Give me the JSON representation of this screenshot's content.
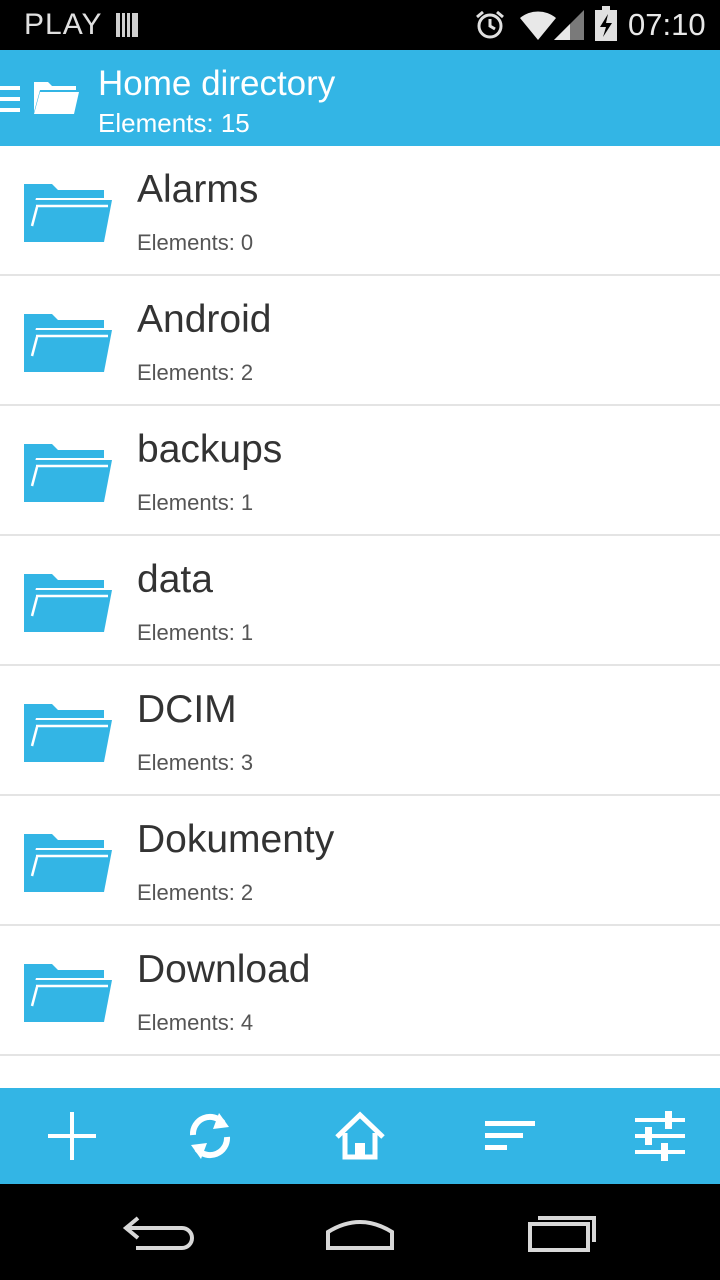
{
  "status_bar": {
    "carrier": "PLAY",
    "time": "07:10",
    "icons": [
      "sim-card-icon",
      "alarm-icon",
      "wifi-icon",
      "signal-icon",
      "battery-charging-icon"
    ]
  },
  "app_bar": {
    "title": "Home directory",
    "subtitle": "Elements: 15",
    "icons": [
      "drawer-menu-icon",
      "folder-icon"
    ]
  },
  "files": [
    {
      "name": "Alarms",
      "count": "Elements: 0"
    },
    {
      "name": "Android",
      "count": "Elements: 2"
    },
    {
      "name": "backups",
      "count": "Elements: 1"
    },
    {
      "name": "data",
      "count": "Elements: 1"
    },
    {
      "name": "DCIM",
      "count": "Elements: 3"
    },
    {
      "name": "Dokumenty",
      "count": "Elements: 2"
    },
    {
      "name": "Download",
      "count": "Elements: 4"
    }
  ],
  "toolbar": {
    "actions": [
      "add-icon",
      "refresh-icon",
      "home-icon",
      "sort-icon",
      "settings-sliders-icon"
    ]
  },
  "nav_bar": {
    "buttons": [
      "back-icon",
      "home-nav-icon",
      "recent-apps-icon"
    ]
  },
  "colors": {
    "accent": "#33b5e5",
    "text_primary": "#333333",
    "text_secondary": "#555555",
    "divider": "#e4e4e4"
  }
}
